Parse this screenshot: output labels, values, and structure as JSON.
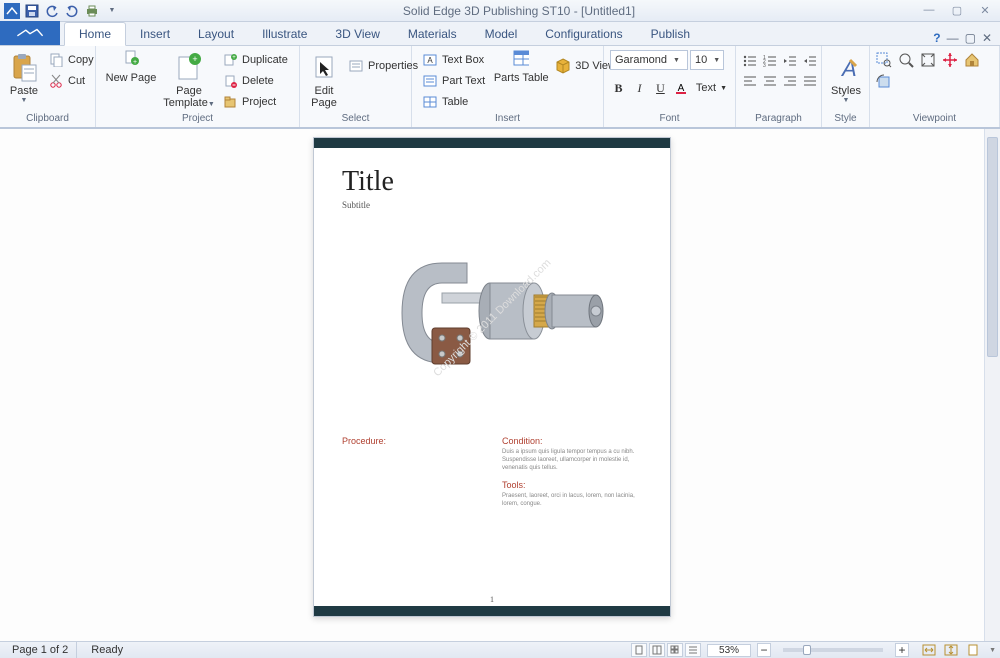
{
  "app": {
    "title": "Solid Edge 3D Publishing  ST10 - [Untitled1]"
  },
  "tabs": [
    "Home",
    "Insert",
    "Layout",
    "Illustrate",
    "3D View",
    "Materials",
    "Model",
    "Configurations",
    "Publish"
  ],
  "active_tab": 0,
  "ribbon": {
    "clipboard": {
      "group": "Clipboard",
      "paste": "Paste",
      "copy": "Copy",
      "cut": "Cut"
    },
    "project": {
      "group": "Project",
      "newpage": "New Page",
      "pagetpl_l1": "Page",
      "pagetpl_l2": "Template",
      "dup": "Duplicate",
      "del": "Delete",
      "proj": "Project"
    },
    "select": {
      "group": "Select",
      "editpage_l1": "Edit",
      "editpage_l2": "Page",
      "props": "Properties"
    },
    "insert": {
      "group": "Insert",
      "textbox": "Text Box",
      "parttext": "Part Text",
      "table": "Table",
      "partstable": "Parts Table",
      "view3d": "3D View"
    },
    "font": {
      "group": "Font",
      "family": "Garamond",
      "size": "10",
      "text": "Text"
    },
    "paragraph": {
      "group": "Paragraph"
    },
    "style": {
      "group": "Style",
      "styles": "Styles"
    },
    "viewpoint": {
      "group": "Viewpoint"
    }
  },
  "document": {
    "title": "Title",
    "subtitle": "Subtitle",
    "watermark": "Copyright © 2011 Download.com",
    "procedure_h": "Procedure:",
    "condition_h": "Condition:",
    "condition_t": "Duis a ipsum quis ligula tempor tempus a cu nibh. Suspendisse laoreet, ullamcorper in molestie id, venenatis quis tellus.",
    "tools_h": "Tools:",
    "tools_t": "Praesent, laoreet, orci in lacus, lorem, non lacinia, lorem, congue.",
    "page_number": "1"
  },
  "status": {
    "page": "Page 1 of 2",
    "ready": "Ready",
    "zoom": "53%"
  }
}
